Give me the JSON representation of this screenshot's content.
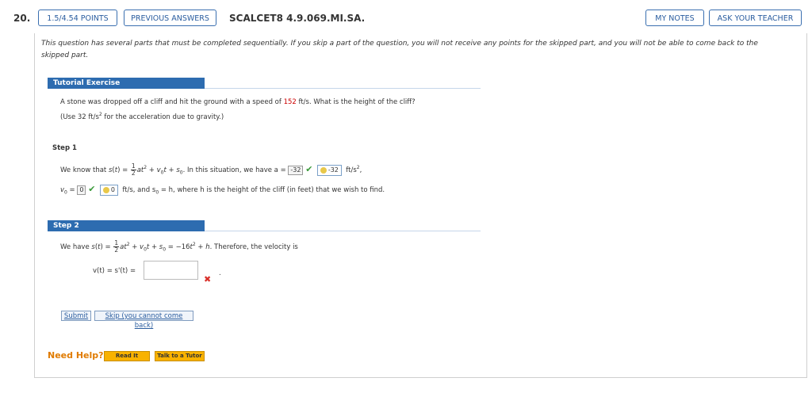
{
  "header": {
    "question_number": "20.",
    "points_button": "1.5/4.54 POINTS",
    "previous_answers_button": "PREVIOUS ANSWERS",
    "question_id": "SCALCET8 4.9.069.MI.SA.",
    "my_notes_button": "MY NOTES",
    "ask_teacher_button": "ASK YOUR TEACHER"
  },
  "notice": "This question has several parts that must be completed sequentially. If you skip a part of the question, you will not receive any points for the skipped part, and you will not be able to come back to the skipped part.",
  "tutorial": {
    "title": "Tutorial Exercise",
    "problem_pre": "A stone was dropped off a cliff and hit the ground with a speed of ",
    "speed": "152",
    "problem_post": " ft/s. What is the height of the cliff?",
    "hint_pre": "(Use 32 ft/s",
    "hint_sup": "2",
    "hint_post": " for the acceleration due to gravity.)"
  },
  "step1": {
    "label": "Step 1",
    "line1_pre": "We know that ",
    "line1_mid": ". In this situation, we have a = ",
    "a_answer": "-32",
    "a_key": "-32",
    "a_units": "ft/s",
    "line2_v0": "v",
    "v0_answer": "0",
    "v0_key": "0",
    "line2_post": "ft/s, and s",
    "line2_end": " = h, where h is the height of the cliff (in feet) that we wish to find."
  },
  "step2": {
    "label": "Step 2",
    "line_pre": "We have ",
    "line_post": ". Therefore, the velocity is",
    "velocity_label": "v(t) = s'(t) =",
    "velocity_input_value": "",
    "trailing_dot": "."
  },
  "buttons": {
    "submit": "Submit",
    "skip": "Skip (you cannot come back)"
  },
  "help": {
    "label": "Need Help?",
    "read_it": "Read It",
    "talk_to_tutor": "Talk to a Tutor"
  }
}
